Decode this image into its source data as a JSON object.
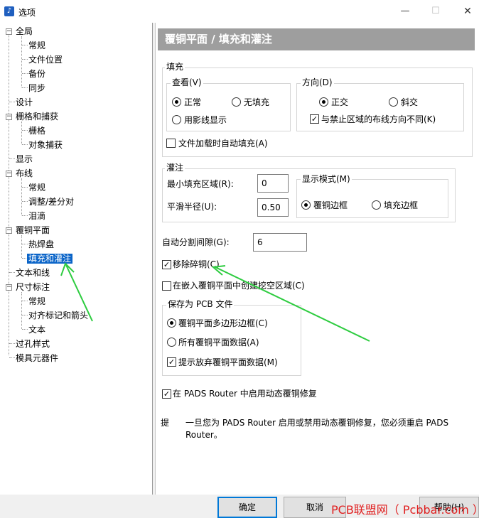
{
  "window": {
    "title": "选项",
    "icon": "music-note-icon"
  },
  "tree": {
    "items": [
      {
        "label": "全局",
        "level": 0,
        "expanded": true
      },
      {
        "label": "常规",
        "level": 1
      },
      {
        "label": "文件位置",
        "level": 1
      },
      {
        "label": "备份",
        "level": 1
      },
      {
        "label": "同步",
        "level": 1
      },
      {
        "label": "设计",
        "level": 0
      },
      {
        "label": "栅格和捕获",
        "level": 0,
        "expanded": true
      },
      {
        "label": "栅格",
        "level": 1
      },
      {
        "label": "对象捕获",
        "level": 1
      },
      {
        "label": "显示",
        "level": 0
      },
      {
        "label": "布线",
        "level": 0,
        "expanded": true
      },
      {
        "label": "常规",
        "level": 1
      },
      {
        "label": "调整/差分对",
        "level": 1
      },
      {
        "label": "泪滴",
        "level": 1
      },
      {
        "label": "覆铜平面",
        "level": 0,
        "expanded": true
      },
      {
        "label": "热焊盘",
        "level": 1
      },
      {
        "label": "填充和灌注",
        "level": 1,
        "selected": true
      },
      {
        "label": "文本和线",
        "level": 0
      },
      {
        "label": "尺寸标注",
        "level": 0,
        "expanded": true
      },
      {
        "label": "常规",
        "level": 1
      },
      {
        "label": "对齐标记和箭头",
        "level": 1
      },
      {
        "label": "文本",
        "level": 1
      },
      {
        "label": "过孔样式",
        "level": 0
      },
      {
        "label": "模具元器件",
        "level": 0
      }
    ]
  },
  "panel": {
    "header": "覆铜平面 / 填充和灌注",
    "fill": {
      "label": "填充",
      "view": {
        "label": "查看(V)",
        "normal": "正常",
        "no_fill": "无填充",
        "hatch": "用影线显示",
        "selected": "normal"
      },
      "direction": {
        "label": "方向(D)",
        "orthogonal": "正交",
        "diagonal": "斜交",
        "diff_restrict": "与禁止区域的布线方向不同(K)",
        "selected": "orthogonal",
        "diff_restrict_checked": true
      },
      "auto_fill_on_load": {
        "label": "文件加载时自动填充(A)",
        "checked": false
      }
    },
    "flood": {
      "label": "灌注",
      "min_fill_area": {
        "label": "最小填充区域(R):",
        "value": "0"
      },
      "smooth_radius": {
        "label": "平滑半径(U):",
        "value": "0.50"
      },
      "display_mode": {
        "label": "显示模式(M)",
        "outline": "覆铜边框",
        "fill_border": "填充边框",
        "selected": "outline"
      }
    },
    "auto_split_gap": {
      "label": "自动分割间隙(G):",
      "value": "6"
    },
    "remove_islands": {
      "label": "移除碎铜(C)",
      "checked": true
    },
    "create_cutouts": {
      "label": "在嵌入覆铜平面中创建挖空区域(C)",
      "checked": false
    },
    "save_as_pcb": {
      "label": "保存为 PCB 文件",
      "polygon_outline": "覆铜平面多边形边框(C)",
      "all_data": "所有覆铜平面数据(A)",
      "selected": "polygon_outline",
      "prompt_discard": {
        "label": "提示放弃覆铜平面数据(M)",
        "checked": true
      }
    },
    "dynamic_repair": {
      "label": "在 PADS Router 中启用动态覆铜修复",
      "checked": true
    },
    "tip": {
      "label": "提",
      "line1": "一旦您为 PADS Router 启用或禁用动态覆铜修复，您必须重启 PADS",
      "line2": "Router。"
    }
  },
  "buttons": {
    "ok": "确定",
    "cancel": "取消",
    "help": "帮助(H)"
  },
  "watermark": "PCB联盟网（ Pcbbar.com ）",
  "colors": {
    "selection": "#0a64c8",
    "header_bg": "#9e9e9e",
    "annotation_arrow": "#2ecc40",
    "watermark": "#e02020"
  }
}
